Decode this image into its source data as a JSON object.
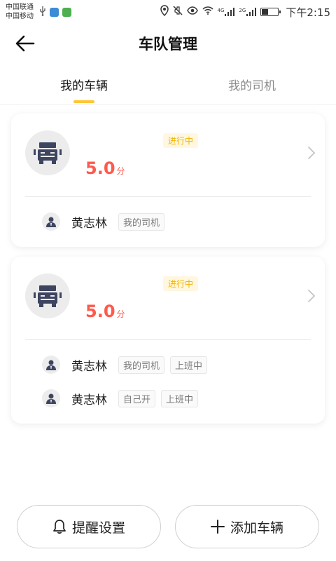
{
  "status_bar": {
    "carrier1": "中国联通",
    "carrier2": "中国移动",
    "net_4g": "4G",
    "net_2g": "2G",
    "time": "下午2:15",
    "battery_level": 0.4
  },
  "header": {
    "title": "车队管理"
  },
  "tabs": [
    {
      "label": "我的车辆",
      "active": true
    },
    {
      "label": "我的司机",
      "active": false
    }
  ],
  "vehicles": [
    {
      "status": "进行中",
      "score": "5.0",
      "score_unit": "分",
      "drivers": [
        {
          "name": "黄志林",
          "tags": [
            "我的司机"
          ]
        }
      ]
    },
    {
      "status": "进行中",
      "score": "5.0",
      "score_unit": "分",
      "drivers": [
        {
          "name": "黄志林",
          "tags": [
            "我的司机",
            "上班中"
          ]
        },
        {
          "name": "黄志林",
          "tags": [
            "自己开",
            "上班中"
          ]
        }
      ]
    }
  ],
  "buttons": {
    "remind_settings": "提醒设置",
    "add_vehicle": "添加车辆"
  },
  "colors": {
    "accent_yellow": "#ffc535",
    "score_red": "#ff5a4e",
    "badge_text": "#f0b400",
    "icon_navy": "#3d4560"
  }
}
